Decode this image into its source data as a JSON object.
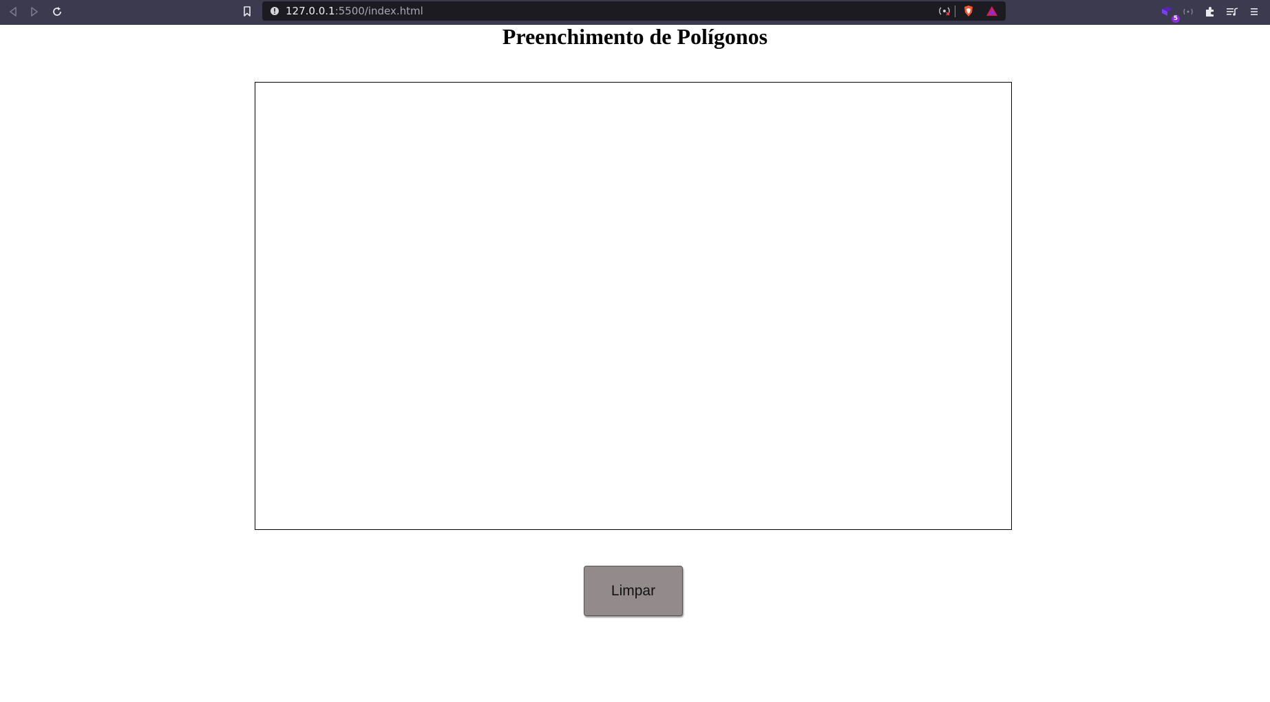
{
  "browser": {
    "url_host": "127.0.0.1",
    "url_path": ":5500/index.html",
    "extension_badge": "5",
    "toolbar_color": "#3b3a4e",
    "icons": [
      "back-icon",
      "forward-icon",
      "reload-icon",
      "bookmark-icon",
      "site-info-icon",
      "media-blocked-icon",
      "brave-shields-icon",
      "brave-rewards-icon",
      "extension-icon",
      "wallet-icon",
      "extensions-puzzle-icon",
      "playlist-icon",
      "menu-icon"
    ]
  },
  "page": {
    "title": "Preenchimento de Polígonos",
    "clear_button_label": "Limpar",
    "button_color": "#938a8c",
    "canvas_border_color": "#000000"
  }
}
